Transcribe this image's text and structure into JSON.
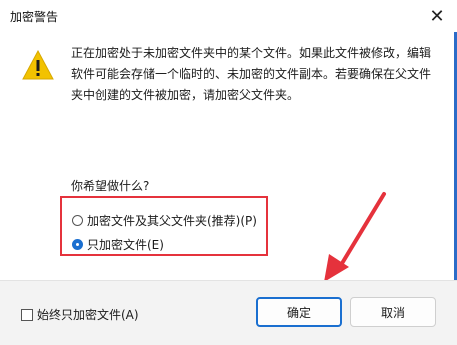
{
  "window": {
    "title": "加密警告"
  },
  "message": {
    "line1": "正在加密处于未加密文件夹中的某个文件。如果此文件被修改，编辑",
    "line2": "软件可能会存储一个临时的、未加密的文件副本。若要确保在父文件",
    "line3": "夹中创建的文件被加密，请加密父文件夹。"
  },
  "question": "你希望做什么?",
  "options": [
    {
      "label": "加密文件及其父文件夹(推荐)(P)",
      "selected": false
    },
    {
      "label": "只加密文件(E)",
      "selected": true
    }
  ],
  "checkbox": {
    "label": "始终只加密文件(A)",
    "checked": false
  },
  "buttons": {
    "ok": "确定",
    "cancel": "取消"
  },
  "icons": {
    "warning": "warning-icon",
    "close": "close-icon"
  },
  "colors": {
    "highlight_box": "#e5323c",
    "accent": "#1a6fd0",
    "warning": "#f2c200"
  }
}
